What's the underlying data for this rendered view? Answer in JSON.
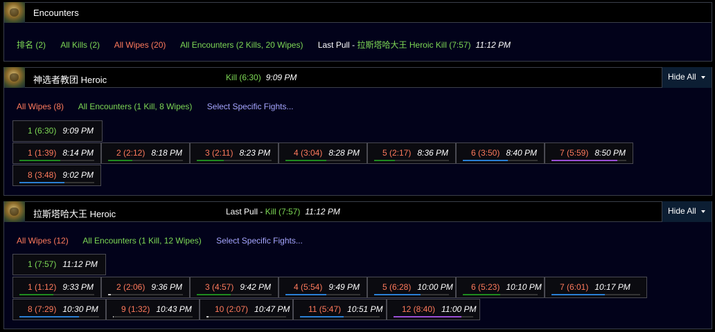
{
  "top": {
    "title": "Encounters",
    "filters": [
      {
        "label": "排名 (2)",
        "color": "green"
      },
      {
        "label": "All Kills (2)",
        "color": "green"
      },
      {
        "label": "All Wipes (20)",
        "color": "red"
      },
      {
        "label": "All Encounters (2 Kills, 20 Wipes)",
        "color": "green"
      }
    ],
    "last_pull_label": "Last Pull",
    "last_pull_sep": " - ",
    "last_pull_fight": "拉斯塔哈大王 Heroic Kill (7:57)",
    "last_pull_time": "11:12 PM"
  },
  "bosses": [
    {
      "title": "神选者教团 Heroic",
      "status_kill": "Kill (6:30)",
      "status_time": "9:09 PM",
      "hide_label": "Hide All",
      "filters": [
        {
          "label": "All Wipes (8)",
          "color": "red"
        },
        {
          "label": "All Encounters (1 Kill, 8 Wipes)",
          "color": "green"
        },
        {
          "label": "Select Specific Fights...",
          "color": "blue"
        }
      ],
      "kills": [
        {
          "label": "1 (6:30)",
          "time": "9:09 PM"
        }
      ],
      "wipes": [
        {
          "label": "1 (1:39)",
          "time": "8:14 PM",
          "progress": 0.55,
          "color": "#1f8a1f"
        },
        {
          "label": "2 (2:12)",
          "time": "8:18 PM",
          "progress": 0.32,
          "color": "#1f8a1f"
        },
        {
          "label": "3 (2:11)",
          "time": "8:23 PM",
          "progress": 0.36,
          "color": "#1f8a1f"
        },
        {
          "label": "4 (3:04)",
          "time": "8:28 PM",
          "progress": 0.55,
          "color": "#1f8a1f"
        },
        {
          "label": "5 (2:17)",
          "time": "8:36 PM",
          "progress": 0.28,
          "color": "#1f8a1f"
        },
        {
          "label": "6 (3:50)",
          "time": "8:40 PM",
          "progress": 0.6,
          "color": "#2a7fd4"
        },
        {
          "label": "7 (5:59)",
          "time": "8:50 PM",
          "progress": 0.88,
          "color": "#9a4fd6"
        },
        {
          "label": "8 (3:48)",
          "time": "9:02 PM",
          "progress": 0.6,
          "color": "#2a7fd4"
        }
      ]
    },
    {
      "title": "拉斯塔哈大王 Heroic",
      "last_pull_label": "Last Pull",
      "status_kill": "Kill (7:57)",
      "status_time": "11:12 PM",
      "hide_label": "Hide All",
      "filters": [
        {
          "label": "All Wipes (12)",
          "color": "red"
        },
        {
          "label": "All Encounters (1 Kill, 12 Wipes)",
          "color": "green"
        },
        {
          "label": "Select Specific Fights...",
          "color": "blue"
        }
      ],
      "kills": [
        {
          "label": "1 (7:57)",
          "time": "11:12 PM"
        }
      ],
      "wipes": [
        {
          "label": "1 (1:12)",
          "time": "9:33 PM",
          "progress": 0.45,
          "color": "#1f8a1f"
        },
        {
          "label": "2 (2:06)",
          "time": "9:36 PM",
          "progress": 0.04,
          "color": "#cccccc"
        },
        {
          "label": "3 (4:57)",
          "time": "9:42 PM",
          "progress": 0.45,
          "color": "#1f8a1f"
        },
        {
          "label": "4 (5:54)",
          "time": "9:49 PM",
          "progress": 0.55,
          "color": "#2a7fd4"
        },
        {
          "label": "5 (6:28)",
          "time": "10:00 PM",
          "progress": 0.62,
          "color": "#2a7fd4"
        },
        {
          "label": "6 (5:23)",
          "time": "10:10 PM",
          "progress": 0.5,
          "color": "#1f8a1f"
        },
        {
          "label": "7 (6:01)",
          "time": "10:17 PM",
          "progress": 0.6,
          "color": "#2a7fd4"
        },
        {
          "label": "8 (7:29)",
          "time": "10:30 PM",
          "progress": 0.75,
          "color": "#2a7fd4"
        },
        {
          "label": "9 (1:32)",
          "time": "10:43 PM",
          "progress": 0.01,
          "color": "#cccccc"
        },
        {
          "label": "10 (2:07)",
          "time": "10:47 PM",
          "progress": 0.03,
          "color": "#cccccc"
        },
        {
          "label": "11 (5:47)",
          "time": "10:51 PM",
          "progress": 0.55,
          "color": "#2a7fd4"
        },
        {
          "label": "12 (8:40)",
          "time": "11:00 PM",
          "progress": 0.85,
          "color": "#9a4fd6"
        }
      ]
    }
  ]
}
